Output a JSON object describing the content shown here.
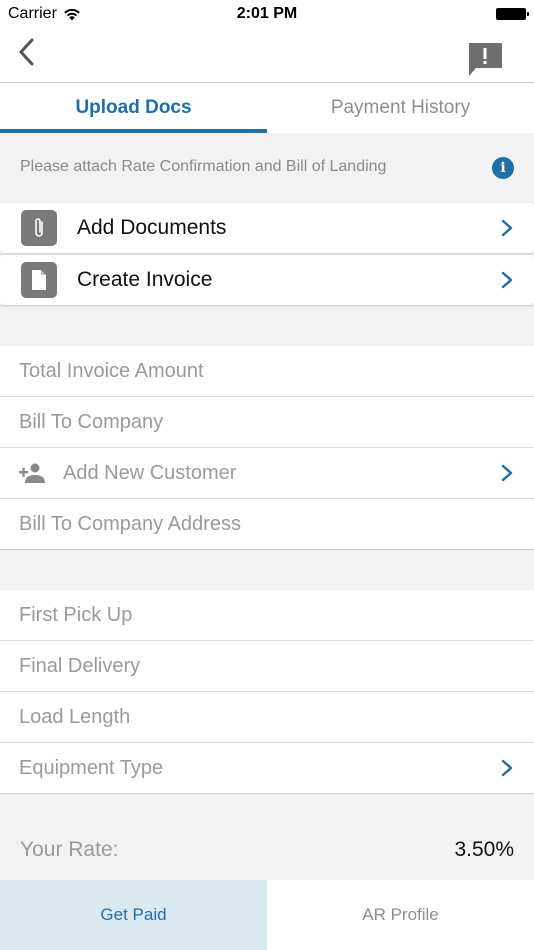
{
  "status_bar": {
    "carrier": "Carrier",
    "time": "2:01 PM"
  },
  "nav": {
    "back_icon": "chevron-left-icon",
    "feedback_icon": "feedback-icon"
  },
  "tabs": [
    {
      "label": "Upload Docs",
      "active": true
    },
    {
      "label": "Payment History",
      "active": false
    }
  ],
  "attach_note": "Please attach Rate Confirmation and Bill of Landing",
  "actions": [
    {
      "label": "Add Documents",
      "icon": "paperclip-icon"
    },
    {
      "label": "Create Invoice",
      "icon": "document-icon"
    }
  ],
  "invoice_fields": {
    "total_invoice_amount": "Total Invoice Amount",
    "bill_to_company": "Bill To Company",
    "add_new_customer": "Add New Customer",
    "bill_to_company_address": "Bill To Company Address"
  },
  "load_fields": {
    "first_pick_up": "First Pick Up",
    "final_delivery": "Final Delivery",
    "load_length": "Load Length",
    "equipment_type": "Equipment Type"
  },
  "rate": {
    "label": "Your Rate:",
    "value": "3.50%"
  },
  "bottom_tabs": [
    {
      "label": "Get Paid",
      "active": true
    },
    {
      "label": "AR Profile",
      "active": false
    }
  ],
  "colors": {
    "accent": "#1f6fa8",
    "background": "#f2f2f2",
    "active_bottom_tab": "#dbe9f3"
  }
}
